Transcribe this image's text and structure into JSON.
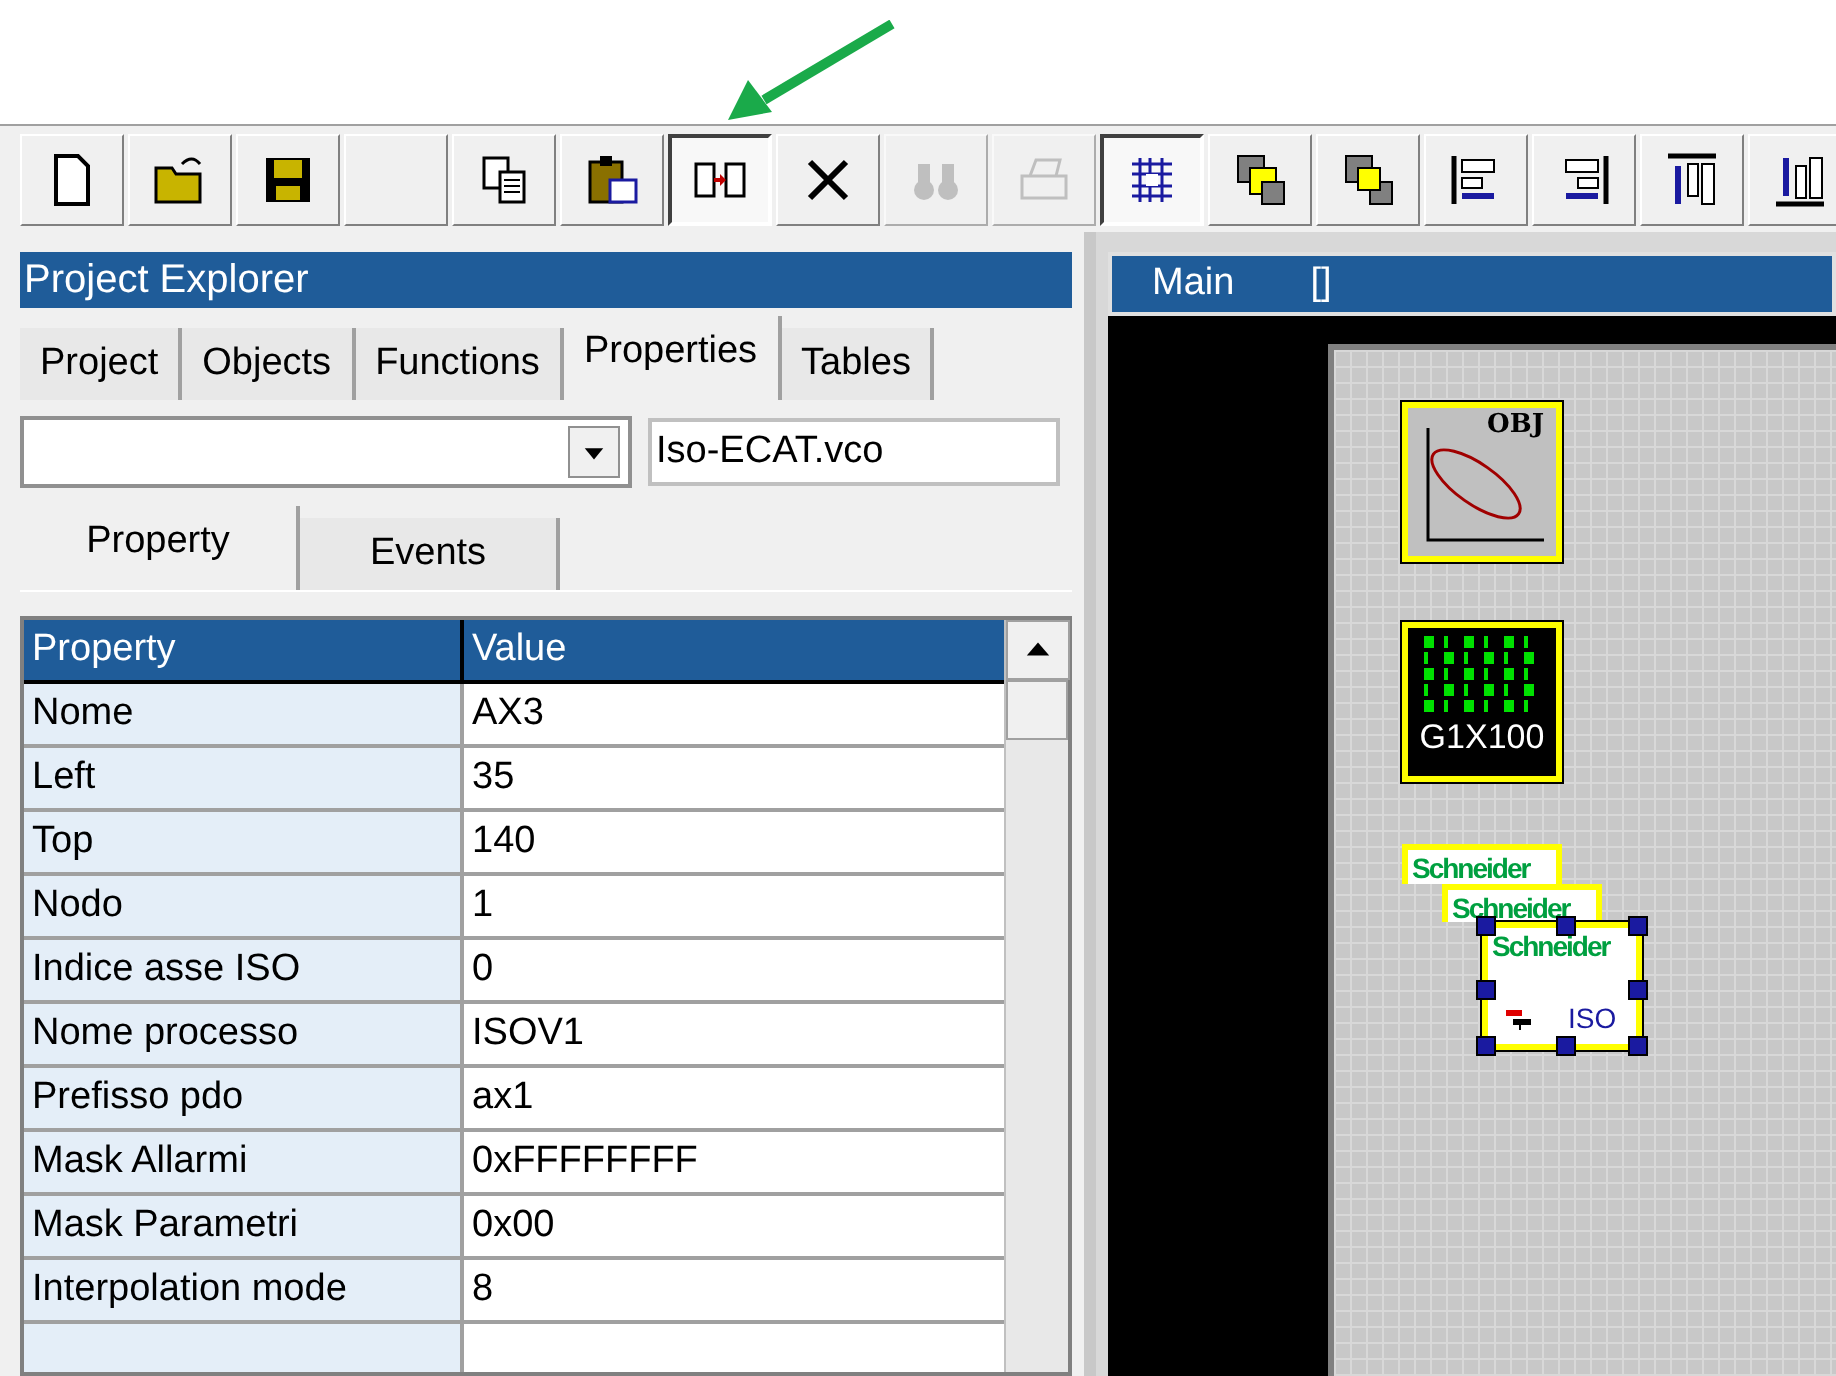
{
  "toolbar": [
    {
      "kind": "new",
      "pressed": false,
      "disabled": false
    },
    {
      "kind": "open",
      "pressed": false,
      "disabled": false
    },
    {
      "kind": "save",
      "pressed": false,
      "disabled": false
    },
    {
      "kind": "blank",
      "pressed": false,
      "disabled": false
    },
    {
      "kind": "copy",
      "pressed": false,
      "disabled": false
    },
    {
      "kind": "paste",
      "pressed": false,
      "disabled": false
    },
    {
      "kind": "swap",
      "pressed": true,
      "disabled": false
    },
    {
      "kind": "delete",
      "pressed": false,
      "disabled": false
    },
    {
      "kind": "find",
      "pressed": false,
      "disabled": true
    },
    {
      "kind": "print",
      "pressed": false,
      "disabled": true
    },
    {
      "kind": "grid",
      "pressed": true,
      "disabled": false
    },
    {
      "kind": "front",
      "pressed": false,
      "disabled": false
    },
    {
      "kind": "back",
      "pressed": false,
      "disabled": false
    },
    {
      "kind": "align_left",
      "pressed": false,
      "disabled": false
    },
    {
      "kind": "align_right",
      "pressed": false,
      "disabled": false
    },
    {
      "kind": "align_top",
      "pressed": false,
      "disabled": false
    },
    {
      "kind": "align_bottom",
      "pressed": false,
      "disabled": false
    }
  ],
  "explorer": {
    "title": "Project Explorer",
    "tabs": [
      {
        "label": "Project",
        "selected": false
      },
      {
        "label": "Objects",
        "selected": false
      },
      {
        "label": "Functions",
        "selected": false
      },
      {
        "label": "Properties",
        "selected": true
      },
      {
        "label": "Tables",
        "selected": false
      }
    ],
    "file_field": {
      "value": "Iso-ECAT.vco"
    },
    "subtabs": [
      {
        "label": "Property",
        "selected": true
      },
      {
        "label": "Events",
        "selected": false
      }
    ],
    "grid": {
      "columns": [
        "Property",
        "Value"
      ],
      "rows": [
        {
          "property": "Nome",
          "value": "AX3"
        },
        {
          "property": "Left",
          "value": "35"
        },
        {
          "property": "Top",
          "value": "140"
        },
        {
          "property": "Nodo",
          "value": "1"
        },
        {
          "property": "Indice asse ISO",
          "value": "0"
        },
        {
          "property": "Nome processo",
          "value": "ISOV1"
        },
        {
          "property": "Prefisso pdo",
          "value": "ax1"
        },
        {
          "property": "Mask Allarmi",
          "value": "0xFFFFFFFF"
        },
        {
          "property": "Mask Parametri",
          "value": "0x00"
        },
        {
          "property": "Interpolation mode",
          "value": "8"
        }
      ]
    }
  },
  "editor": {
    "title": "Main",
    "subtitle": "[]",
    "objects": [
      {
        "kind": "plot",
        "label": "OBJ",
        "selected": false
      },
      {
        "kind": "display",
        "label": "G1X100",
        "selected": false
      },
      {
        "kind": "drive",
        "label": "Schneider",
        "selected": false
      },
      {
        "kind": "drive",
        "label": "Schneider",
        "selected": false
      },
      {
        "kind": "drive",
        "label": "Schneider",
        "tag": "ISO",
        "selected": true
      }
    ]
  }
}
